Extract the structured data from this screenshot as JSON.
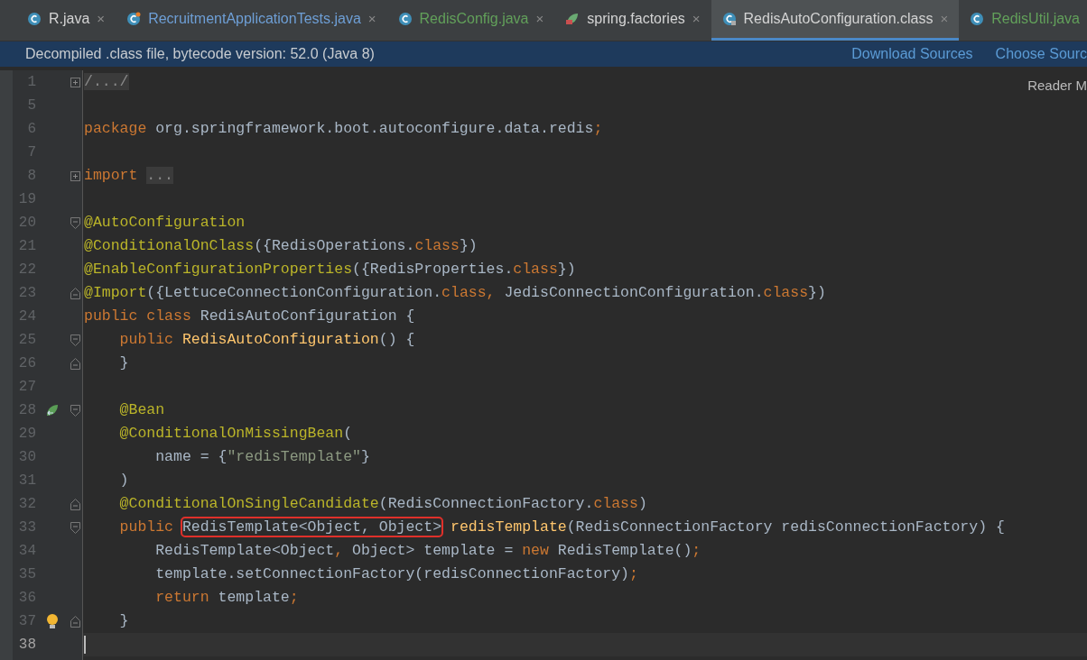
{
  "tabs": [
    {
      "label": "R.java",
      "kind": "class",
      "color": "#d4d4d4",
      "selected": false,
      "close": "×"
    },
    {
      "label": "RecruitmentApplicationTests.java",
      "kind": "test",
      "color": "#6e9fd6",
      "selected": false,
      "close": "×"
    },
    {
      "label": "RedisConfig.java",
      "kind": "class",
      "color": "#62a05a",
      "selected": false,
      "close": "×"
    },
    {
      "label": "spring.factories",
      "kind": "spring",
      "color": "#d4d4d4",
      "selected": false,
      "close": "×"
    },
    {
      "label": "RedisAutoConfiguration.class",
      "kind": "locked",
      "color": "#d4d4d4",
      "selected": true,
      "close": "×"
    },
    {
      "label": "RedisUtil.java",
      "kind": "class",
      "color": "#62a05a",
      "selected": false
    }
  ],
  "info_bar": {
    "message": "Decompiled .class file, bytecode version: 52.0 (Java 8)",
    "links": [
      "Download Sources",
      "Choose Sourc"
    ]
  },
  "reader_mode": "Reader M",
  "lines": [
    {
      "number": "1",
      "markers": [
        {
          "kind": "expand"
        }
      ],
      "tokens": [
        {
          "text": "/.../",
          "kind": "folded"
        }
      ]
    },
    {
      "number": "5"
    },
    {
      "number": "6",
      "tokens": [
        {
          "text": "package",
          "kind": "keyword"
        },
        {
          "text": " org.springframework.boot.autoconfigure.data.redis",
          "kind": "plain"
        },
        {
          "text": ";",
          "kind": "keyword"
        }
      ]
    },
    {
      "number": "7"
    },
    {
      "number": "8",
      "markers": [
        {
          "kind": "expand"
        }
      ],
      "tokens": [
        {
          "text": "import ",
          "kind": "keyword"
        },
        {
          "text": "...",
          "kind": "folded"
        }
      ]
    },
    {
      "number": "19"
    },
    {
      "number": "20",
      "markers": [
        {
          "kind": "fold_start"
        }
      ],
      "tokens": [
        {
          "text": "@AutoConfiguration",
          "kind": "annotation"
        }
      ]
    },
    {
      "number": "21",
      "tokens": [
        {
          "text": "@ConditionalOnClass",
          "kind": "annotation"
        },
        {
          "text": "({RedisOperations.",
          "kind": "plain"
        },
        {
          "text": "class",
          "kind": "keyword"
        },
        {
          "text": "})",
          "kind": "plain"
        }
      ]
    },
    {
      "number": "22",
      "tokens": [
        {
          "text": "@EnableConfigurationProperties",
          "kind": "annotation"
        },
        {
          "text": "({RedisProperties.",
          "kind": "plain"
        },
        {
          "text": "class",
          "kind": "keyword"
        },
        {
          "text": "})",
          "kind": "plain"
        }
      ]
    },
    {
      "number": "23",
      "markers": [
        {
          "kind": "fold_end"
        }
      ],
      "tokens": [
        {
          "text": "@Import",
          "kind": "annotation"
        },
        {
          "text": "({LettuceConnectionConfiguration.",
          "kind": "plain"
        },
        {
          "text": "class, ",
          "kind": "keyword"
        },
        {
          "text": "JedisConnectionConfiguration.",
          "kind": "plain"
        },
        {
          "text": "class",
          "kind": "keyword"
        },
        {
          "text": "})",
          "kind": "plain"
        }
      ]
    },
    {
      "number": "24",
      "tokens": [
        {
          "text": "public class ",
          "kind": "keyword"
        },
        {
          "text": "RedisAutoConfiguration {",
          "kind": "plain"
        }
      ]
    },
    {
      "number": "25",
      "markers": [
        {
          "kind": "fold_start"
        }
      ],
      "tokens": [
        {
          "text": "    public ",
          "kind": "keyword"
        },
        {
          "text": "RedisAutoConfiguration",
          "kind": "method"
        },
        {
          "text": "() {",
          "kind": "plain"
        }
      ]
    },
    {
      "number": "26",
      "markers": [
        {
          "kind": "fold_end"
        }
      ],
      "tokens": [
        {
          "text": "    }",
          "kind": "plain"
        }
      ]
    },
    {
      "number": "27"
    },
    {
      "number": "28",
      "markers": [
        {
          "kind": "bean"
        },
        {
          "kind": "fold_start"
        }
      ],
      "tokens": [
        {
          "text": "    @Bean",
          "kind": "annotation"
        }
      ]
    },
    {
      "number": "29",
      "tokens": [
        {
          "text": "    @ConditionalOnMissingBean",
          "kind": "annotation"
        },
        {
          "text": "(",
          "kind": "plain"
        }
      ]
    },
    {
      "number": "30",
      "tokens": [
        {
          "text": "        name = {",
          "kind": "plain"
        },
        {
          "text": "\"redisTemplate\"",
          "kind": "string"
        },
        {
          "text": "}",
          "kind": "plain"
        }
      ]
    },
    {
      "number": "31",
      "tokens": [
        {
          "text": "    )",
          "kind": "plain"
        }
      ]
    },
    {
      "number": "32",
      "markers": [
        {
          "kind": "fold_end"
        }
      ],
      "tokens": [
        {
          "text": "    @ConditionalOnSingleCandidate",
          "kind": "annotation"
        },
        {
          "text": "(RedisConnectionFactory.",
          "kind": "plain"
        },
        {
          "text": "class",
          "kind": "keyword"
        },
        {
          "text": ")",
          "kind": "plain"
        }
      ]
    },
    {
      "number": "33",
      "markers": [
        {
          "kind": "fold_start"
        }
      ],
      "tokens": [
        {
          "text": "    public ",
          "kind": "keyword"
        },
        {
          "text": "RedisTemplate<Object, Object>",
          "kind": "boxed"
        },
        {
          "text": " redisTemplate",
          "kind": "method"
        },
        {
          "text": "(RedisConnectionFactory redisConnectionFactory) {",
          "kind": "plain"
        }
      ]
    },
    {
      "number": "34",
      "tokens": [
        {
          "text": "        RedisTemplate<Object",
          "kind": "plain"
        },
        {
          "text": ", ",
          "kind": "keyword"
        },
        {
          "text": "Object> template = ",
          "kind": "plain"
        },
        {
          "text": "new ",
          "kind": "keyword"
        },
        {
          "text": "RedisTemplate()",
          "kind": "plain"
        },
        {
          "text": ";",
          "kind": "keyword"
        }
      ]
    },
    {
      "number": "35",
      "tokens": [
        {
          "text": "        template.setConnectionFactory(redisConnectionFactory)",
          "kind": "plain"
        },
        {
          "text": ";",
          "kind": "keyword"
        }
      ]
    },
    {
      "number": "36",
      "tokens": [
        {
          "text": "        return ",
          "kind": "keyword"
        },
        {
          "text": "template",
          "kind": "plain"
        },
        {
          "text": ";",
          "kind": "keyword"
        }
      ]
    },
    {
      "number": "37",
      "markers": [
        {
          "kind": "bulb"
        },
        {
          "kind": "fold_end"
        }
      ],
      "tokens": [
        {
          "text": "    }",
          "kind": "plain"
        }
      ]
    },
    {
      "number": "38",
      "current": true
    }
  ]
}
